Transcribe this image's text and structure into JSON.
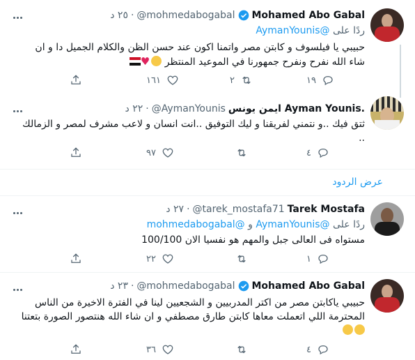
{
  "tweets": [
    {
      "name": "Mohamed Abo Gabal",
      "verified": true,
      "handle": "@mohmedabogabal",
      "time": "٢٥ د",
      "replying_prefix": "ردًا على",
      "replying_to": "@AymanYounis",
      "replying_joiner": "",
      "replying_to_2": "",
      "text": "حبيبي يا فيلسوف و كابتن مصر واتمنا اكون عند حسن الظن والكلام الجميل دا و ان شاء الله نفرح ونفرح جمهورنا في الموعيد المنتظر",
      "emojis": [
        "hugging-face",
        "red-heart",
        "egypt-flag"
      ],
      "counts": {
        "replies": "١٩",
        "retweets": "٢",
        "likes": "١٦١"
      }
    },
    {
      "name": "ايمن يونس Ayman Younis.",
      "verified": false,
      "handle": "@AymanYounis",
      "time": "٢٢ د",
      "text": "ثتق فيك ..و نتمني لفريقنا و ليك التوفيق ..انت انسان و لاعب مشرف لمصر و الزمالك ..",
      "counts": {
        "replies": "٤",
        "retweets": "",
        "likes": "٩٧"
      }
    },
    {
      "name": "Tarek Mostafa",
      "verified": false,
      "handle": "@tarek_mostafa71",
      "time": "٢٧ د",
      "replying_prefix": "ردًا على",
      "replying_to": "@AymanYounis",
      "replying_joiner": "و",
      "replying_to_2": "@mohmedabogabal",
      "text": "مستواه فى العالى جبل والمهم هو نفسيا الان 100/100",
      "counts": {
        "replies": "١",
        "retweets": "",
        "likes": "٢٢"
      }
    },
    {
      "name": "Mohamed Abo Gabal",
      "verified": true,
      "handle": "@mohmedabogabal",
      "time": "٢٣ د",
      "text": "حبيبي ياكابتن مصر من اكتر المدربيين و الشجعيين لينا في الفترة الاخيرة من الناس المحترمة اللي اتعملت معاها كابتن طارق مصطفي و ان شاء الله هنتصور الصورة بتعتنا",
      "emojis": [
        "hugging-face",
        "smiling-face"
      ],
      "counts": {
        "replies": "٤",
        "retweets": "",
        "likes": "٣٦"
      }
    }
  ],
  "show_replies": "عرض الردود",
  "icons": {
    "verified": "verified-badge-icon",
    "reply": "reply-icon",
    "retweet": "retweet-icon",
    "like": "like-icon",
    "share": "share-icon",
    "more": "more-icon"
  },
  "colors": {
    "accent": "#1d9bf0",
    "secondary": "#536471",
    "separator": "#eff3f4"
  }
}
